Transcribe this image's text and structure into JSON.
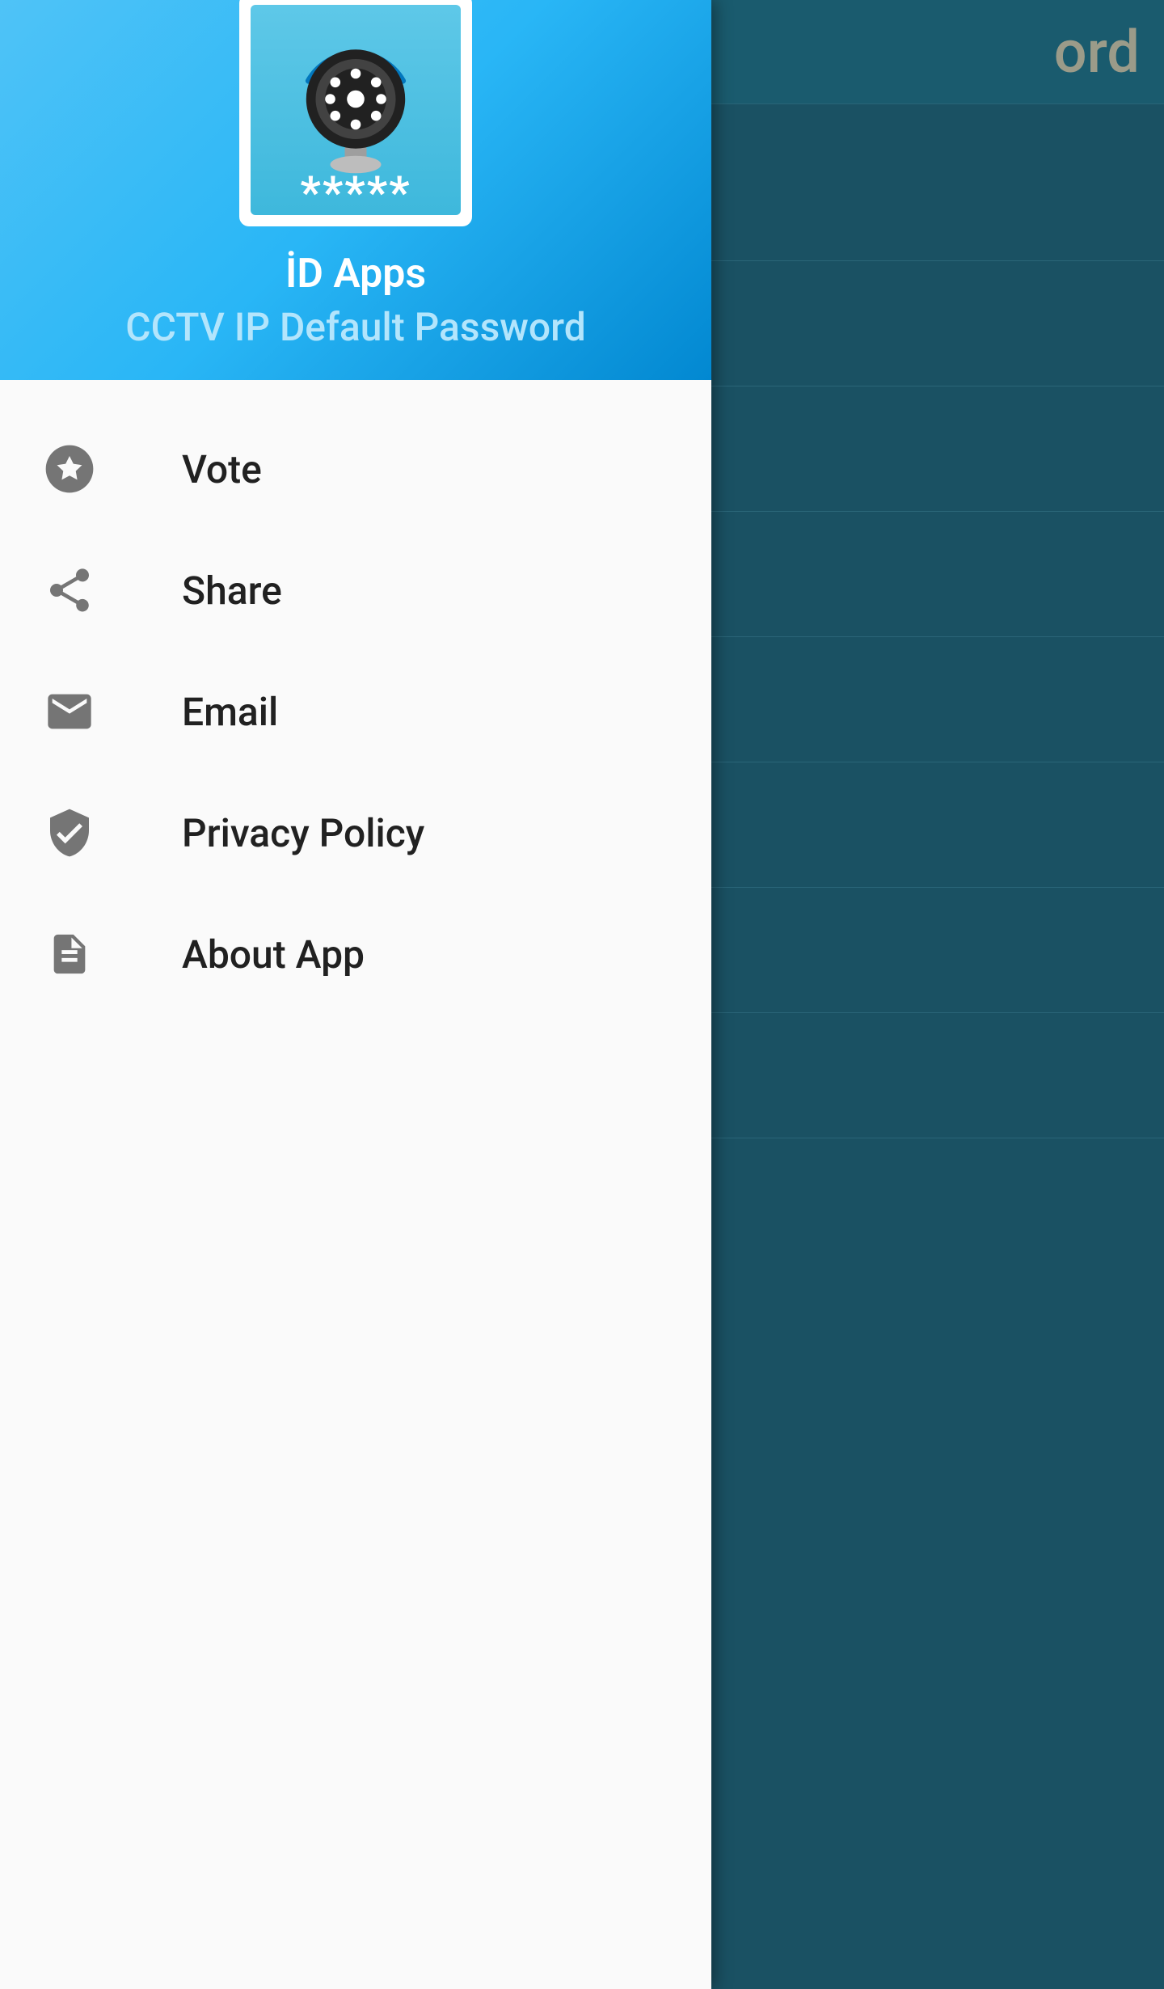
{
  "background": {
    "appbar_title_visible": "ord"
  },
  "drawer": {
    "publisher": "İD Apps",
    "app_name": "CCTV IP Default Password",
    "asterisks": "*****",
    "menu_items": [
      {
        "icon": "star-icon",
        "label": "Vote"
      },
      {
        "icon": "share-icon",
        "label": "Share"
      },
      {
        "icon": "email-icon",
        "label": "Email"
      },
      {
        "icon": "shield-check-icon",
        "label": "Privacy Policy"
      },
      {
        "icon": "document-icon",
        "label": "About App"
      }
    ]
  }
}
